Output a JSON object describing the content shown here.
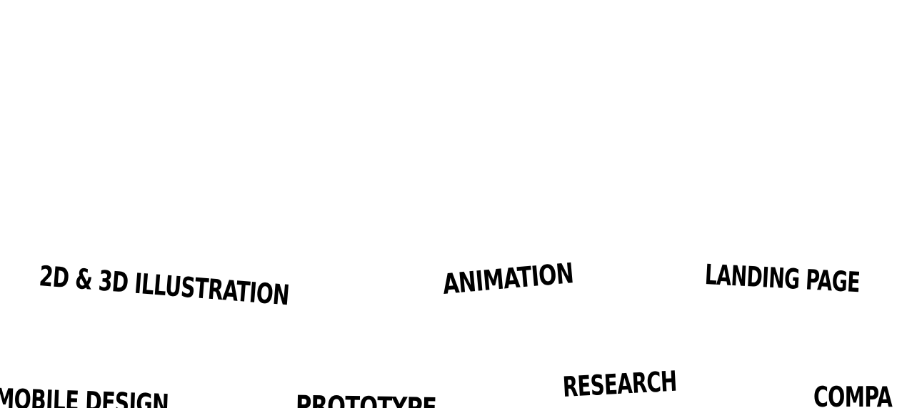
{
  "background_color": "#ffffff",
  "text_color": "#000000",
  "words": {
    "illustration": "2D & 3D ILLUSTRATION",
    "animation": "ANIMATION",
    "landing_page": "LANDING PAGE",
    "mobile_design": "MOBILE DESIGN",
    "prototype": "PROTOTYPE",
    "research": "RESEARCH",
    "company": "COMPA"
  }
}
